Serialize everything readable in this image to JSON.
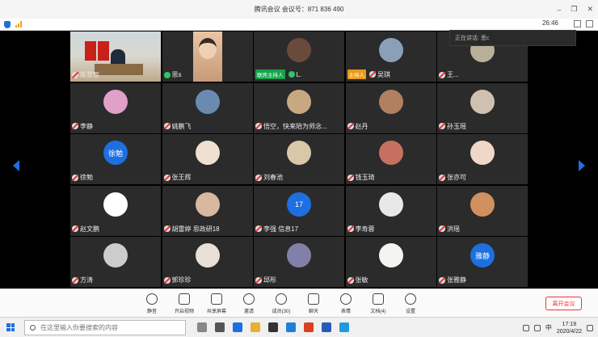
{
  "window": {
    "title": "腾讯会议 会议号：871 836 490"
  },
  "topstrip": {
    "timer": "26:46"
  },
  "speaking": {
    "text": "正在讲话: 思c"
  },
  "participants": [
    {
      "name": "陈登智",
      "type": "video1",
      "mic": "off"
    },
    {
      "name": "思s",
      "type": "video2",
      "mic": "on"
    },
    {
      "name": "L.",
      "badge": "联席主持人",
      "badge_color": "green",
      "mic": "on",
      "avatar_color": "#6a4a3a"
    },
    {
      "name": "吴琪",
      "badge": "主持人",
      "badge_color": "orange",
      "mic": "off",
      "avatar_color": "#8aa0b8"
    },
    {
      "name": "王...",
      "mic": "off",
      "avatar_color": "#b8b098"
    },
    {
      "name": "李静",
      "mic": "off",
      "avatar_color": "#e0a0c8"
    },
    {
      "name": "姚鹏飞",
      "mic": "off",
      "avatar_color": "#6a8ab0"
    },
    {
      "name": "悟空，快来陪为师念...",
      "mic": "off",
      "avatar_color": "#c8a880"
    },
    {
      "name": "赵丹",
      "mic": "off",
      "avatar_color": "#b08060"
    },
    {
      "name": "孙玉瑶",
      "mic": "off",
      "avatar_color": "#d0c0b0"
    },
    {
      "name": "徐勉",
      "mic": "off",
      "avatar_color": "#1e6fe0",
      "avatar_text": "徐勉"
    },
    {
      "name": "张王辉",
      "mic": "off",
      "avatar_color": "#f0e0d0"
    },
    {
      "name": "刘春池",
      "mic": "off",
      "avatar_color": "#d8c8a8"
    },
    {
      "name": "钱玉琦",
      "mic": "off",
      "avatar_color": "#c87060"
    },
    {
      "name": "张亦可",
      "mic": "off",
      "avatar_color": "#f0d8c8"
    },
    {
      "name": "赵文鹏",
      "mic": "off",
      "avatar_color": "#ffffff"
    },
    {
      "name": "胡雷婷 思政研18",
      "mic": "off",
      "avatar_color": "#d8b8a0"
    },
    {
      "name": "李强 信息17",
      "mic": "off",
      "avatar_color": "#1e6fe0",
      "avatar_text": "17"
    },
    {
      "name": "李寿蓉",
      "mic": "off",
      "avatar_color": "#e8e8e8"
    },
    {
      "name": "洪瑶",
      "mic": "off",
      "avatar_color": "#d09060"
    },
    {
      "name": "方涛",
      "mic": "off",
      "avatar_color": "#cccccc"
    },
    {
      "name": "郭珍珍",
      "mic": "off",
      "avatar_color": "#e8e0d8"
    },
    {
      "name": "邱彤",
      "mic": "off",
      "avatar_color": "#8080a8"
    },
    {
      "name": "张敏",
      "mic": "off",
      "avatar_color": "#f4f4f0"
    },
    {
      "name": "张雅静",
      "mic": "off",
      "avatar_color": "#1e6fe0",
      "avatar_text": "雅静"
    }
  ],
  "controls": {
    "items": [
      {
        "label": "静音",
        "icon": "microphone-icon"
      },
      {
        "label": "开启视频",
        "icon": "camera-off-icon"
      },
      {
        "label": "共享屏幕",
        "icon": "screen-share-icon"
      },
      {
        "label": "邀请",
        "icon": "invite-icon"
      },
      {
        "label": "成员(30)",
        "icon": "members-icon"
      },
      {
        "label": "聊天",
        "icon": "chat-icon"
      },
      {
        "label": "表情",
        "icon": "emoji-icon"
      },
      {
        "label": "文档(4)",
        "icon": "document-icon"
      },
      {
        "label": "设置",
        "icon": "settings-icon"
      }
    ],
    "leave_label": "离开会议"
  },
  "taskbar": {
    "search_placeholder": "在这里输入你要搜索的内容",
    "ime": "中",
    "time": "17:19",
    "date": "2020/4/22",
    "app_colors": [
      "#888888",
      "#555555",
      "#1e6fe0",
      "#e8b030",
      "#333333",
      "#1e7fd8",
      "#d84020",
      "#2a5ab8",
      "#1e9ae0"
    ]
  }
}
